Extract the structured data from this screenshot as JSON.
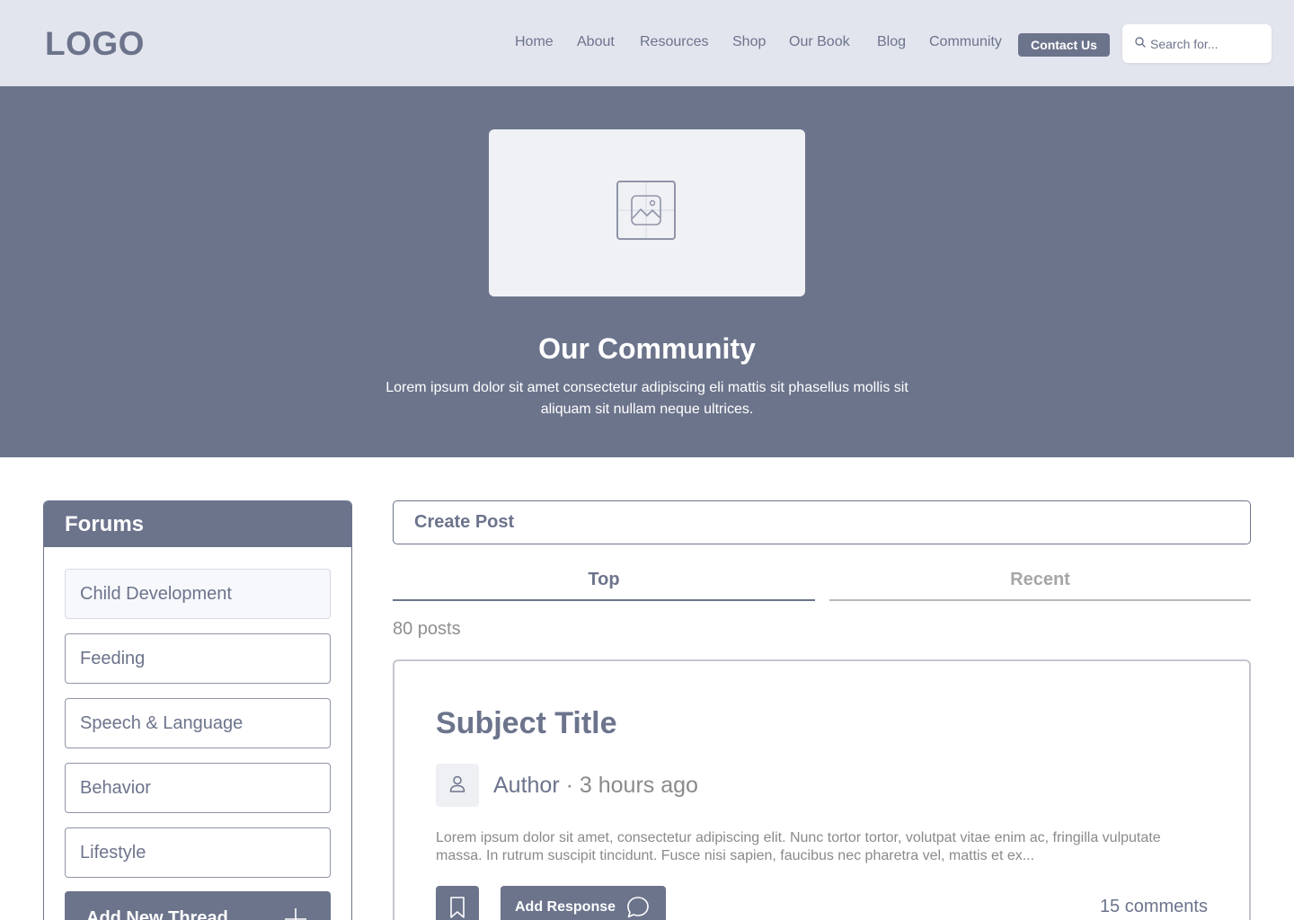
{
  "header": {
    "logo": "LOGO",
    "nav": [
      {
        "label": "Home"
      },
      {
        "label": "About"
      },
      {
        "label": "Resources"
      },
      {
        "label": "Shop"
      },
      {
        "label": "Our Book"
      },
      {
        "label": "Blog"
      },
      {
        "label": "Community"
      }
    ],
    "contact_label": "Contact Us",
    "search_placeholder": "Search for..."
  },
  "hero": {
    "title": "Our Community",
    "description": "Lorem ipsum dolor sit amet consectetur adipiscing eli mattis sit phasellus mollis sit aliquam sit nullam neque ultrices."
  },
  "forums": {
    "title": "Forums",
    "items": [
      {
        "label": "Child Development"
      },
      {
        "label": "Feeding"
      },
      {
        "label": "Speech & Language"
      },
      {
        "label": "Behavior"
      },
      {
        "label": "Lifestyle"
      }
    ],
    "add_thread_label": "Add New Thread"
  },
  "feed": {
    "create_post_label": "Create Post",
    "tabs": [
      {
        "label": "Top"
      },
      {
        "label": "Recent"
      }
    ],
    "post_count": "80 posts",
    "post": {
      "title": "Subject Title",
      "author": "Author",
      "separator": " · ",
      "time": "3 hours ago",
      "body": "Lorem ipsum dolor sit amet, consectetur adipiscing elit. Nunc tortor tortor, volutpat vitae enim ac, fringilla vulputate massa. In rutrum suscipit tincidunt. Fusce nisi sapien, faucibus nec pharetra vel, mattis et ex...",
      "respond_label": "Add Response",
      "comments": "15 comments"
    }
  },
  "colors": {
    "accent": "#6c748c",
    "header_bg": "#e3e5ee",
    "image_placeholder": "#f0f1f5"
  },
  "icons": [
    "search-icon",
    "image-placeholder-icon",
    "user-icon",
    "bookmark-icon",
    "chat-bubble-icon",
    "plus-icon"
  ]
}
